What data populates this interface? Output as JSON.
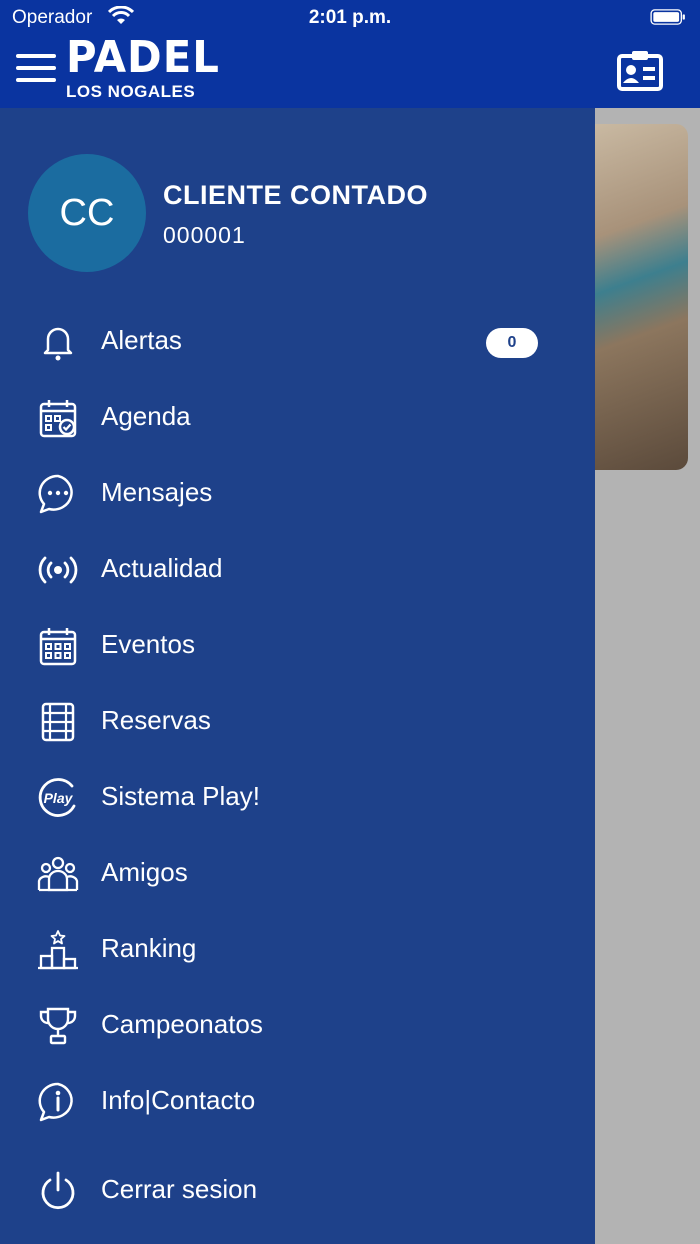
{
  "status_bar": {
    "carrier": "Operador",
    "time": "2:01 p.m."
  },
  "header": {
    "logo_main": "PADEL",
    "logo_sub": "LOS NOGALES"
  },
  "user": {
    "initials": "CC",
    "name": "CLIENTE CONTADO",
    "id": "000001"
  },
  "menu": {
    "items": [
      {
        "label": "Alertas",
        "icon": "bell-icon",
        "badge": "0"
      },
      {
        "label": "Agenda",
        "icon": "calendar-check-icon"
      },
      {
        "label": "Mensajes",
        "icon": "chat-bubble-icon"
      },
      {
        "label": "Actualidad",
        "icon": "broadcast-icon"
      },
      {
        "label": "Eventos",
        "icon": "calendar-grid-icon"
      },
      {
        "label": "Reservas",
        "icon": "court-icon"
      },
      {
        "label": "Sistema Play!",
        "icon": "play-badge-icon"
      },
      {
        "label": "Amigos",
        "icon": "friends-icon"
      },
      {
        "label": "Ranking",
        "icon": "podium-icon"
      },
      {
        "label": "Campeonatos",
        "icon": "trophy-icon"
      },
      {
        "label": "Info|Contacto",
        "icon": "info-bubble-icon"
      },
      {
        "label": "Cerrar sesion",
        "icon": "power-icon"
      }
    ]
  },
  "colors": {
    "header": "#0a34a0",
    "drawer": "#1e418a",
    "avatar": "#1b6ca0",
    "overlay": "#b3b3b3"
  }
}
